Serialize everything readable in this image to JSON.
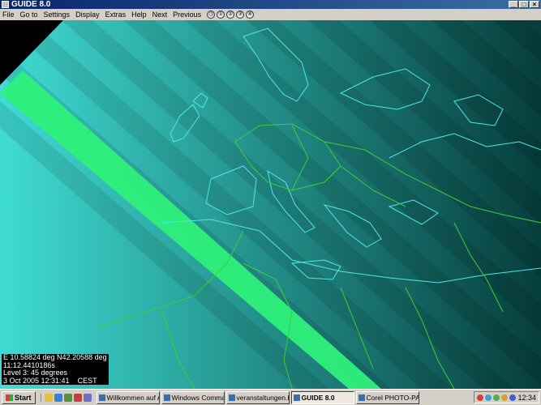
{
  "window": {
    "title": "GUIDE 8.0",
    "buttons": [
      "_",
      "□",
      "×"
    ]
  },
  "menu": {
    "items": [
      "File",
      "Go to",
      "Settings",
      "Display",
      "Extras",
      "Help",
      "Next",
      "Previous"
    ],
    "tool_icons": [
      "◷",
      "①",
      "②",
      "③",
      "④"
    ]
  },
  "readout": {
    "coords": "E 10.58824 deg N42.20588 deg",
    "time": "11:12.4410186s",
    "level": "Level 3: 45 degrees",
    "date": "3 Oct 2005 12:31:41",
    "tz": "CEST"
  },
  "map": {
    "colors": {
      "band_light": "#2fd0c8",
      "band_dark": "#0a5a56",
      "central_line": "#2ef07a",
      "coast": "#4ee8e6",
      "border": "#3ecf32"
    }
  },
  "taskbar": {
    "start_label": "Start",
    "tasks": [
      "Willkommen auf A...",
      "Windows Comma...",
      "veranstaltungen.h...",
      "GUIDE 8.0",
      "Corel PHOTO-PAI..."
    ],
    "active_task": "GUIDE 8.0",
    "clock": "12:34"
  }
}
